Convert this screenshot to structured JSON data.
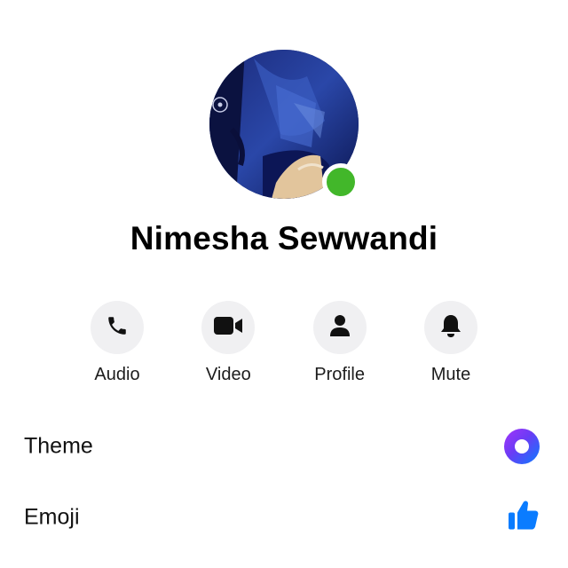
{
  "contact": {
    "name": "Nimesha Sewwandi",
    "online": true
  },
  "actions": [
    {
      "label": "Audio",
      "icon": "phone-icon"
    },
    {
      "label": "Video",
      "icon": "video-camera-icon"
    },
    {
      "label": "Profile",
      "icon": "person-icon"
    },
    {
      "label": "Mute",
      "icon": "bell-icon"
    }
  ],
  "settings": {
    "theme_label": "Theme",
    "emoji_label": "Emoji"
  },
  "colors": {
    "online_status": "#42b72a",
    "emoji_thumb": "#0a7cff",
    "theme_gradient_start": "#a334fa",
    "theme_gradient_end": "#0a7cff"
  }
}
